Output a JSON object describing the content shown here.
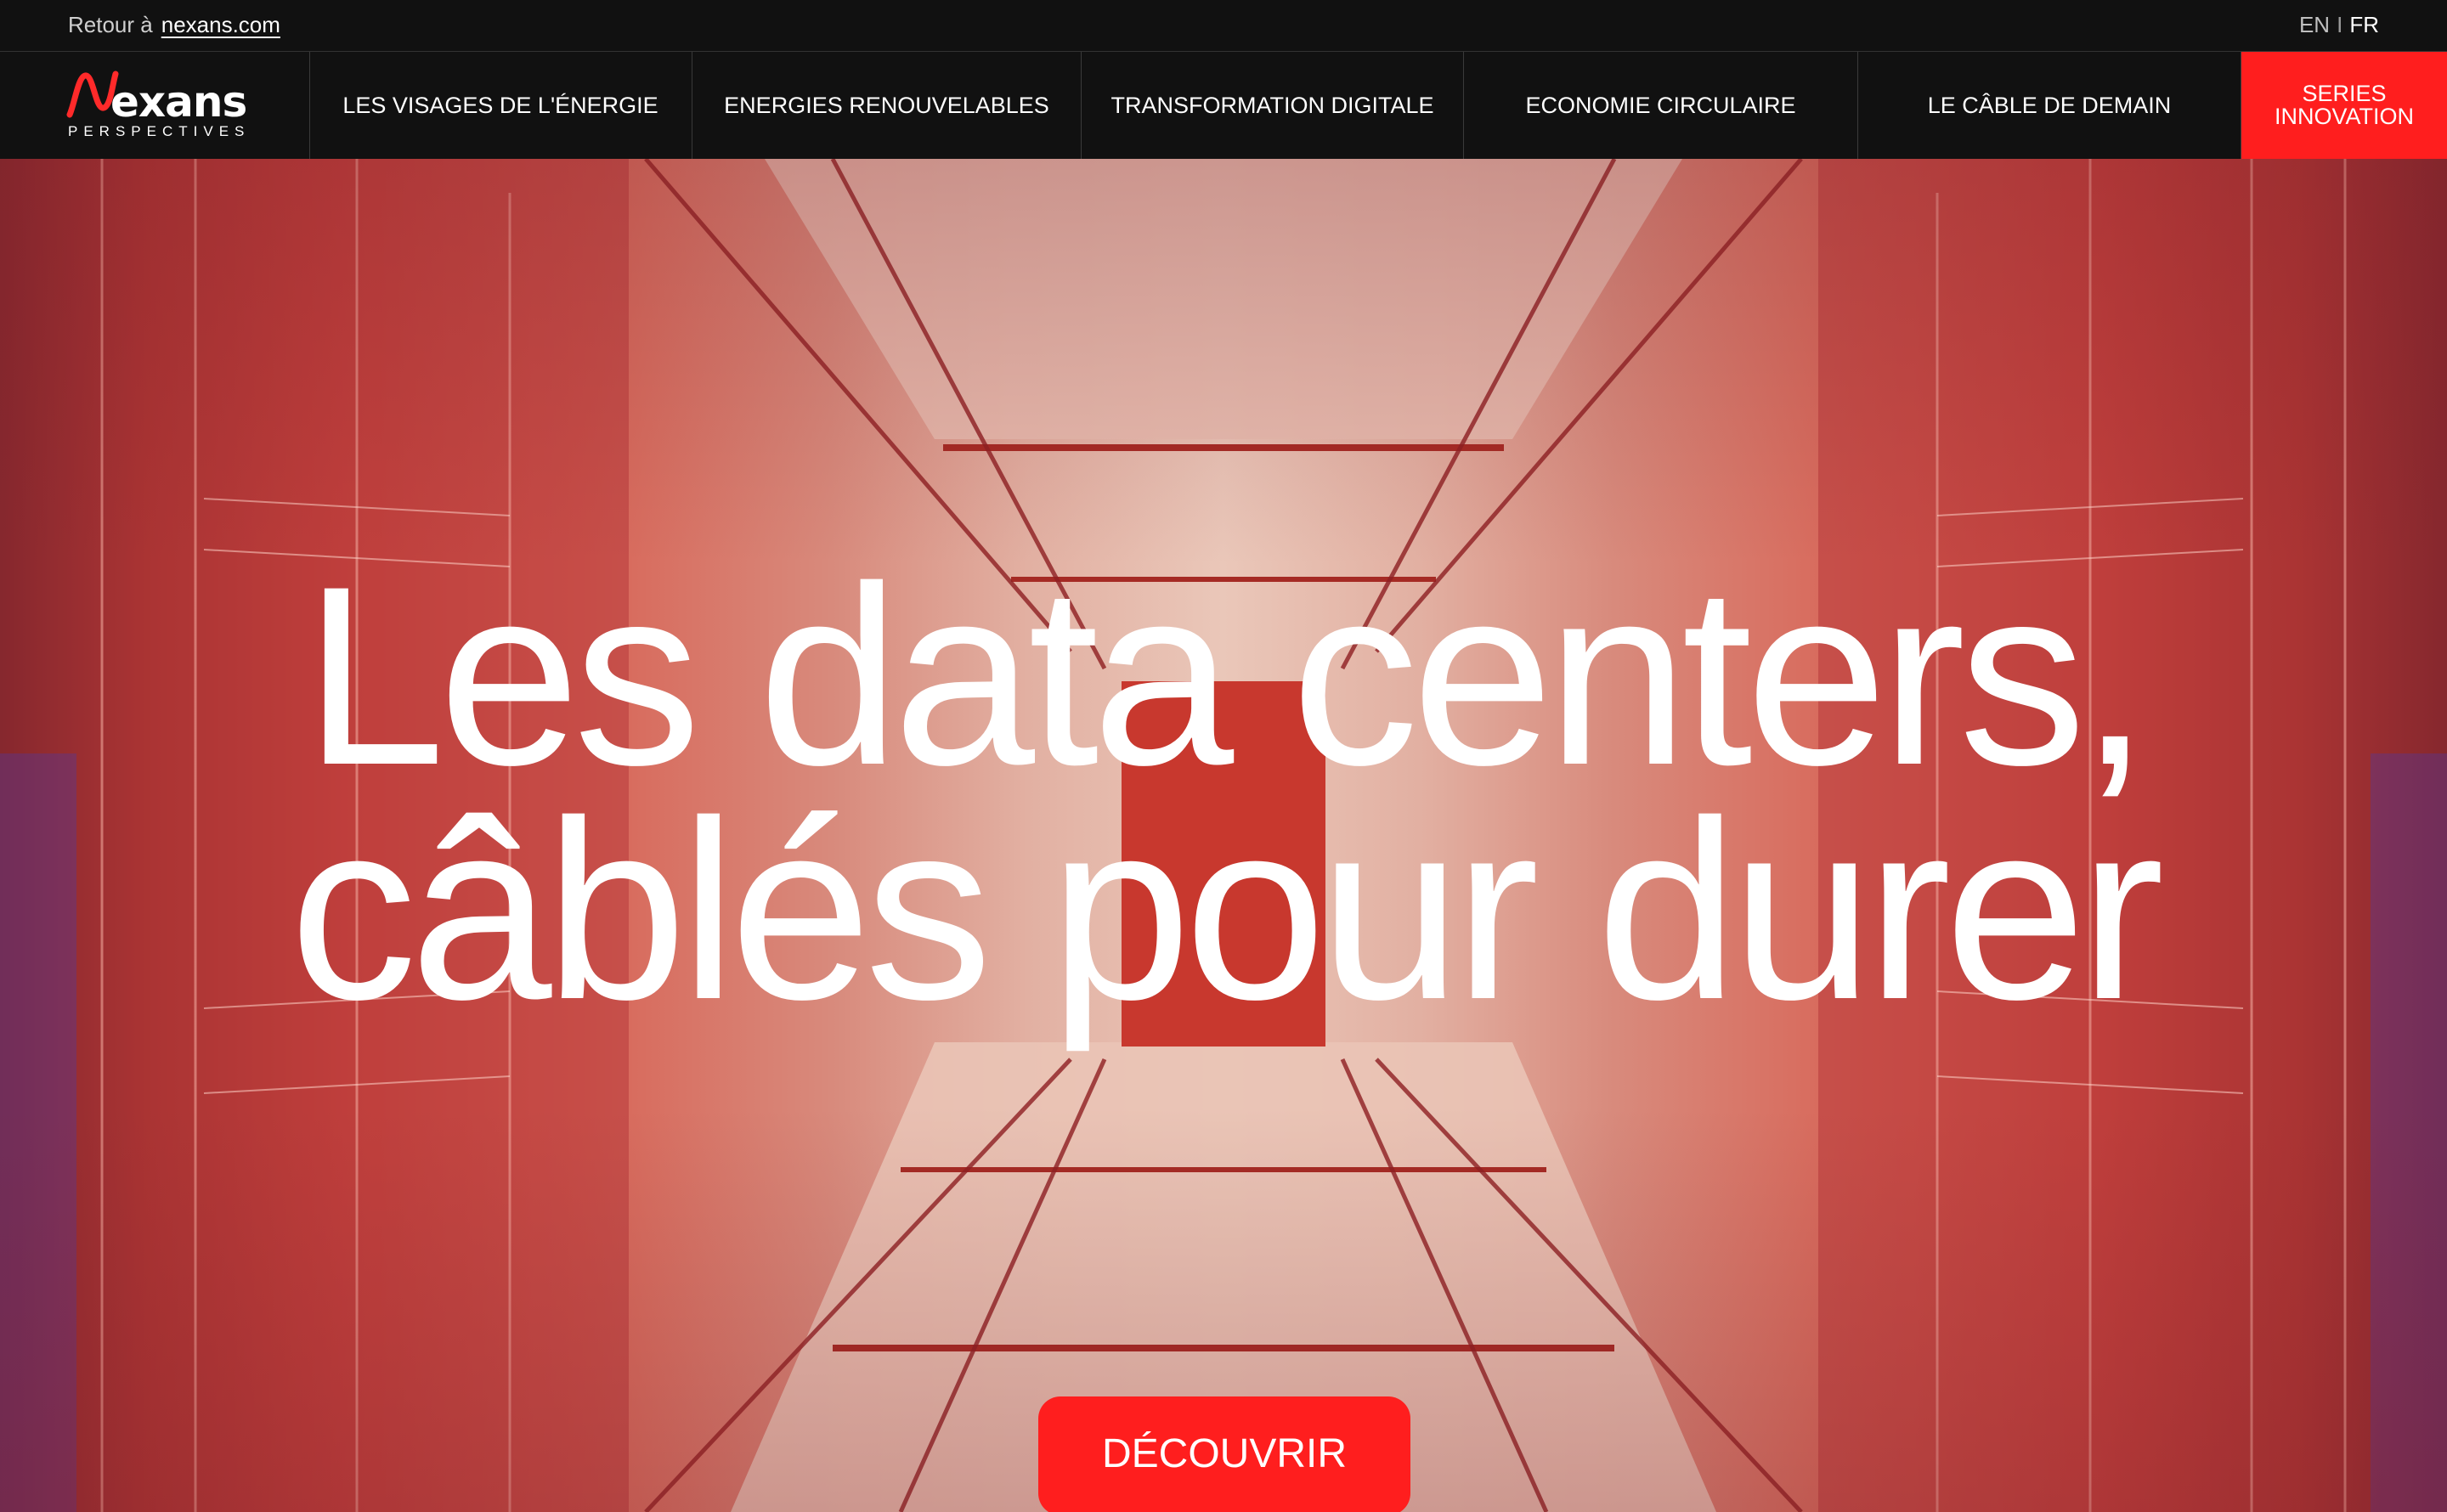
{
  "topbar": {
    "back_prefix": "Retour à",
    "back_link": "nexans.com",
    "lang_en": "EN",
    "lang_sep": "I",
    "lang_fr": "FR"
  },
  "logo": {
    "brand": "exans",
    "subtitle": "PERSPECTIVES",
    "icon": "nexans-n-logo"
  },
  "nav": {
    "items": [
      {
        "label": "LES VISAGES DE L'ÉNERGIE"
      },
      {
        "label": "ENERGIES RENOUVELABLES"
      },
      {
        "label": "TRANSFORMATION DIGITALE"
      },
      {
        "label": "ECONOMIE CIRCULAIRE"
      },
      {
        "label": "LE CÂBLE DE DEMAIN"
      }
    ],
    "highlight_line1": "SERIES",
    "highlight_line2": "INNOVATION"
  },
  "hero": {
    "headline_line1": "Les data centers,",
    "headline_line2": "câblés pour durer",
    "cta": "DÉCOUVRIR"
  },
  "colors": {
    "accent": "#ff1e1e",
    "bar": "#111111",
    "text": "#ffffff"
  }
}
